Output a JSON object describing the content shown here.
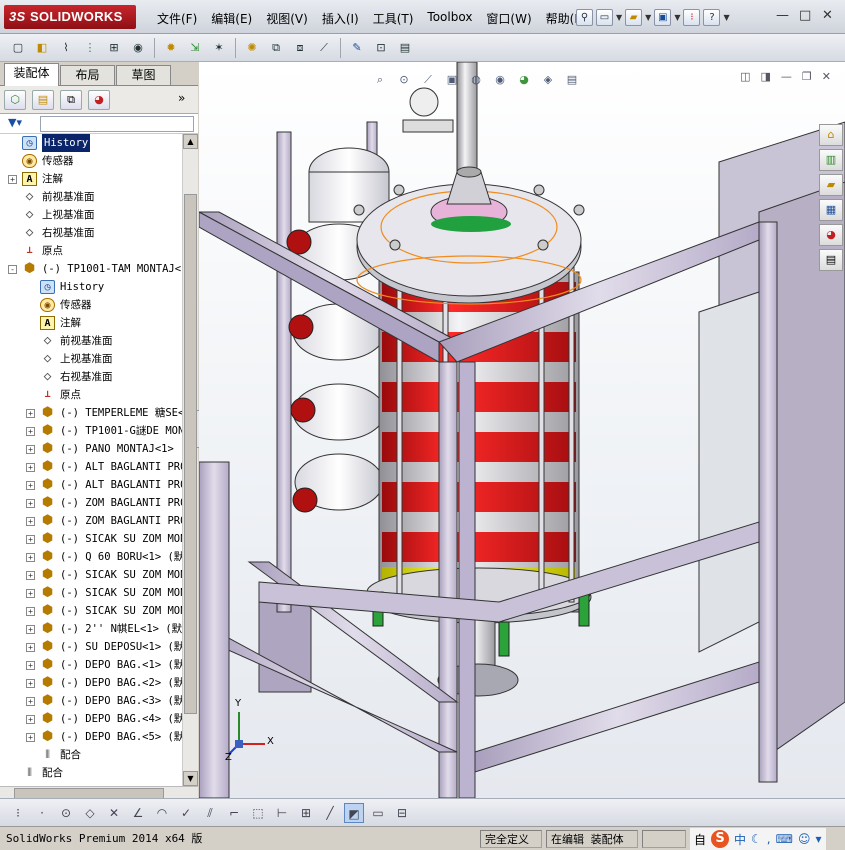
{
  "app": {
    "logo_prefix": "3S",
    "logo_text": "SOLIDWORKS"
  },
  "menu": [
    "文件(F)",
    "编辑(E)",
    "视图(V)",
    "插入(I)",
    "工具(T)",
    "Toolbox",
    "窗口(W)",
    "帮助(H)"
  ],
  "window_controls": {
    "minimize": "—",
    "restore": "□",
    "close": "✕"
  },
  "manager_tabs": [
    {
      "label": "装配体",
      "active": true
    },
    {
      "label": "布局",
      "active": false
    },
    {
      "label": "草图",
      "active": false
    }
  ],
  "tree": [
    {
      "indent": 0,
      "exp": "",
      "icon": "history",
      "label": "History",
      "selected": true
    },
    {
      "indent": 0,
      "exp": "",
      "icon": "sensor",
      "label": "传感器"
    },
    {
      "indent": 0,
      "exp": "+",
      "icon": "annotation",
      "label": "注解"
    },
    {
      "indent": 0,
      "exp": "",
      "icon": "plane",
      "label": "前视基准面"
    },
    {
      "indent": 0,
      "exp": "",
      "icon": "plane",
      "label": "上视基准面"
    },
    {
      "indent": 0,
      "exp": "",
      "icon": "plane",
      "label": "右视基准面"
    },
    {
      "indent": 0,
      "exp": "",
      "icon": "origin",
      "label": "原点"
    },
    {
      "indent": 0,
      "exp": "-",
      "icon": "assembly",
      "label": "(-) TP1001-TAM MONTAJ<1"
    },
    {
      "indent": 1,
      "exp": "",
      "icon": "history",
      "label": "History"
    },
    {
      "indent": 1,
      "exp": "",
      "icon": "sensor",
      "label": "传感器"
    },
    {
      "indent": 1,
      "exp": "",
      "icon": "annotation",
      "label": "注解"
    },
    {
      "indent": 1,
      "exp": "",
      "icon": "plane",
      "label": "前视基准面"
    },
    {
      "indent": 1,
      "exp": "",
      "icon": "plane",
      "label": "上视基准面"
    },
    {
      "indent": 1,
      "exp": "",
      "icon": "plane",
      "label": "右视基准面"
    },
    {
      "indent": 1,
      "exp": "",
      "icon": "origin",
      "label": "原点"
    },
    {
      "indent": 1,
      "exp": "+",
      "icon": "assembly",
      "label": "(-) TEMPERLEME 糖SE<"
    },
    {
      "indent": 1,
      "exp": "+",
      "icon": "assembly",
      "label": "(-) TP1001-G謎DE MON"
    },
    {
      "indent": 1,
      "exp": "+",
      "icon": "assembly",
      "label": "(-) PANO MONTAJ<1> ("
    },
    {
      "indent": 1,
      "exp": "+",
      "icon": "assembly",
      "label": "(-) ALT BAGLANTI PRO"
    },
    {
      "indent": 1,
      "exp": "+",
      "icon": "assembly",
      "label": "(-) ALT BAGLANTI PRO"
    },
    {
      "indent": 1,
      "exp": "+",
      "icon": "assembly",
      "label": "(-) ZOM BAGLANTI PRO"
    },
    {
      "indent": 1,
      "exp": "+",
      "icon": "assembly",
      "label": "(-) ZOM BAGLANTI PRO"
    },
    {
      "indent": 1,
      "exp": "+",
      "icon": "assembly",
      "label": "(-) SICAK SU ZOM MON"
    },
    {
      "indent": 1,
      "exp": "+",
      "icon": "assembly",
      "label": "(-) Q 60 BORU<1> (默"
    },
    {
      "indent": 1,
      "exp": "+",
      "icon": "assembly",
      "label": "(-) SICAK SU ZOM MON"
    },
    {
      "indent": 1,
      "exp": "+",
      "icon": "assembly",
      "label": "(-) SICAK SU ZOM MON"
    },
    {
      "indent": 1,
      "exp": "+",
      "icon": "assembly",
      "label": "(-) SICAK SU ZOM MON"
    },
    {
      "indent": 1,
      "exp": "+",
      "icon": "assembly",
      "label": "(-) 2'' N帺EL<1> (默"
    },
    {
      "indent": 1,
      "exp": "+",
      "icon": "assembly",
      "label": "(-) SU DEPOSU<1> (默"
    },
    {
      "indent": 1,
      "exp": "+",
      "icon": "assembly",
      "label": "(-) DEPO BAG.<1> (默"
    },
    {
      "indent": 1,
      "exp": "+",
      "icon": "assembly",
      "label": "(-) DEPO BAG.<2> (默"
    },
    {
      "indent": 1,
      "exp": "+",
      "icon": "assembly",
      "label": "(-) DEPO BAG.<3> (默"
    },
    {
      "indent": 1,
      "exp": "+",
      "icon": "assembly",
      "label": "(-) DEPO BAG.<4> (默"
    },
    {
      "indent": 1,
      "exp": "+",
      "icon": "assembly",
      "label": "(-) DEPO BAG.<5> (默"
    },
    {
      "indent": 1,
      "exp": "",
      "icon": "mate",
      "label": "配合"
    },
    {
      "indent": 0,
      "exp": "",
      "icon": "mate",
      "label": "配合"
    }
  ],
  "triad": {
    "x": "X",
    "y": "Y",
    "z": "Z"
  },
  "status": {
    "product": "SolidWorks Premium 2014 x64 版",
    "definition": "完全定义",
    "mode": "在编辑 装配体",
    "ime_trailing": "自",
    "ime_lang": "中"
  },
  "colors": {
    "frame": "#c8bfd6",
    "red": "#e0191d",
    "yellow": "#ffff29",
    "selection": "#0a246a"
  }
}
